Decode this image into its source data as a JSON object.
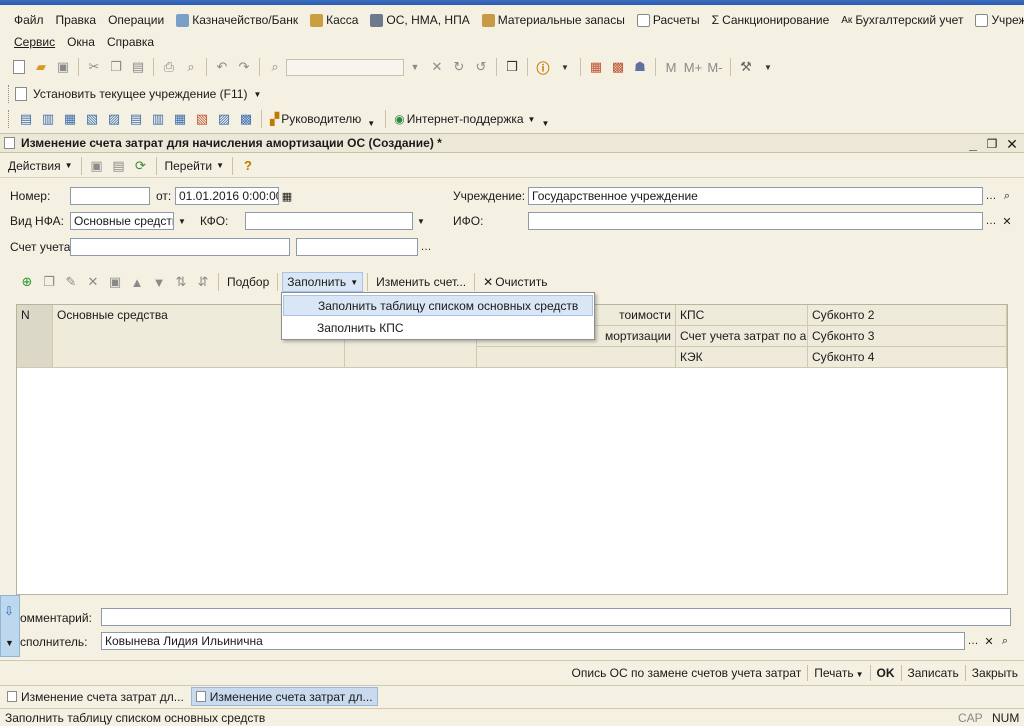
{
  "menu": {
    "row1": [
      "Файл",
      "Правка",
      "Операции",
      "Казначейство/Банк",
      "Касса",
      "ОС, НМА, НПА",
      "Материальные запасы",
      "Расчеты",
      "Санкционирование",
      "Бухгалтерский учет",
      "Учреждение"
    ],
    "row2": [
      "Сервис",
      "Окна",
      "Справка"
    ]
  },
  "toolbar2": {
    "set_institution": "Установить текущее учреждение (F11)"
  },
  "toolbar3": {
    "head": "Руководителю",
    "support": "Интернет-поддержка"
  },
  "toolbar1": {
    "m": "M",
    "mplus": "M+",
    "mminus": "M-"
  },
  "window": {
    "title": "Изменение счета затрат для начисления амортизации ОС (Создание) *"
  },
  "actions": {
    "actions": "Действия",
    "goto": "Перейти"
  },
  "form": {
    "number_label": "Номер:",
    "number_value": "",
    "date_label": "от:",
    "date_value": "01.01.2016  0:00:00",
    "institution_label": "Учреждение:",
    "institution_value": "Государственное учреждение",
    "nfa_label": "Вид НФА:",
    "nfa_value": "Основные средства",
    "kfo_label": "КФО:",
    "kfo_value": "",
    "ifo_label": "ИФО:",
    "ifo_value": "",
    "account_label": "Счет учета:",
    "account_value": "",
    "account2_value": ""
  },
  "table_toolbar": {
    "select": "Подбор",
    "fill": "Заполнить",
    "change_account": "Изменить счет...",
    "clear": "Очистить"
  },
  "dropdown": {
    "item1": "Заполнить таблицу списком основных средств",
    "item2": "Заполнить КПС"
  },
  "grid": {
    "col_n": "N",
    "col_os": "Основные средства",
    "col_cost": "тоимости",
    "col_amort": "мортизации",
    "col_kps": "КПС",
    "col_account": "Счет учета затрат по а...",
    "col_kek": "КЭК",
    "col_sub2": "Субконто 2",
    "col_sub3": "Субконто 3",
    "col_sub4": "Субконто 4"
  },
  "comment": {
    "label": "омментарий:",
    "value": ""
  },
  "executor": {
    "label": "сполнитель:",
    "value": "Ковынева Лидия Ильинична"
  },
  "bottom": {
    "report": "Опись ОС по замене счетов учета затрат",
    "print": "Печать",
    "ok": "OK",
    "save": "Записать",
    "close": "Закрыть"
  },
  "taskbar": {
    "tab1": "Изменение счета затрат дл...",
    "tab2": "Изменение счета затрат дл..."
  },
  "status": {
    "text": "Заполнить таблицу списком основных средств",
    "cap": "CAP",
    "num": "NUM"
  },
  "colors": {
    "background": "#f4f0e2",
    "highlight": "#d9e6f5",
    "active_tab": "#c9d9ee"
  }
}
